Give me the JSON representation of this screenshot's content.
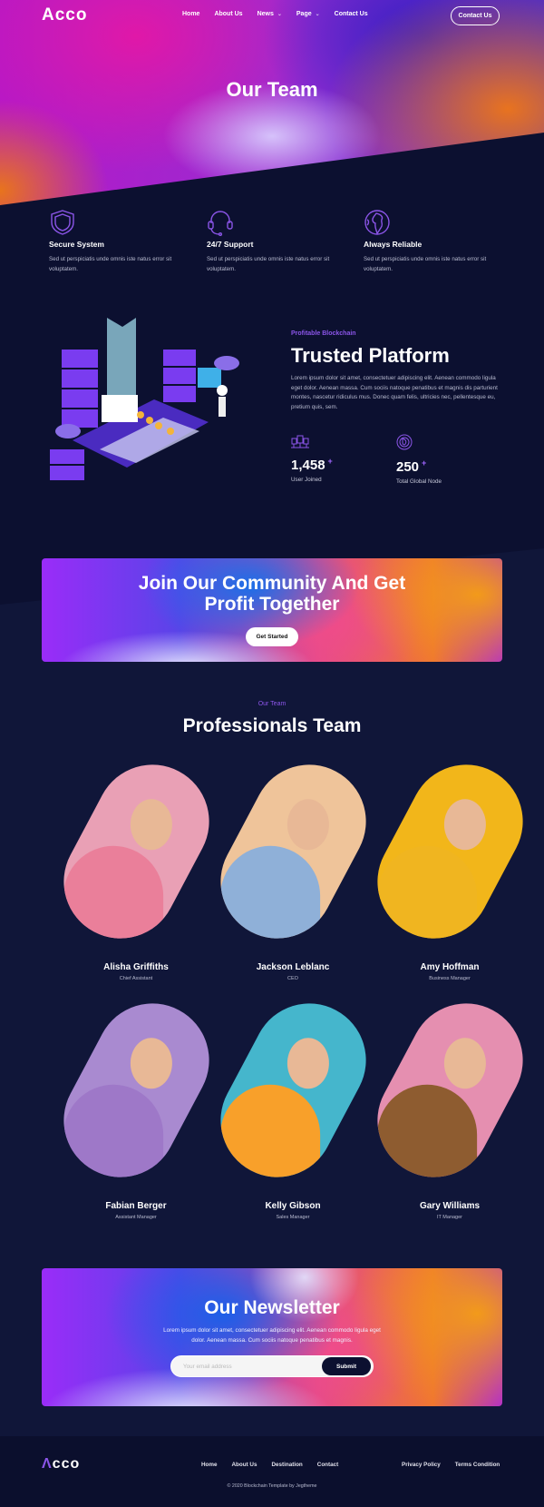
{
  "brand": {
    "logo": "Acco",
    "accent": "#8b55e8",
    "bg_dark": "#0c1030",
    "bg": "#101639"
  },
  "nav": {
    "items": [
      {
        "label": "Home"
      },
      {
        "label": "About Us"
      },
      {
        "label": "News",
        "dropdown": true
      },
      {
        "label": "Page",
        "dropdown": true
      },
      {
        "label": "Contact Us"
      }
    ],
    "cta": "Contact Us"
  },
  "hero": {
    "title": "Our Team"
  },
  "features": [
    {
      "icon": "shield-icon",
      "title": "Secure System",
      "text": "Sed ut perspiciatis unde omnis iste natus error sit voluptatem."
    },
    {
      "icon": "headset-icon",
      "title": "24/7 Support",
      "text": "Sed ut perspiciatis unde omnis iste natus error sit voluptatem."
    },
    {
      "icon": "globe-icon",
      "title": "Always Reliable",
      "text": "Sed ut perspiciatis unde omnis iste natus error sit voluptatem."
    }
  ],
  "platform": {
    "kicker": "Profitable Blockchain",
    "title": "Trusted Platform",
    "text": "Lorem ipsum dolor sit amet, consectetuer adipiscing elit. Aenean commodo ligula eget dolor. Aenean massa. Cum sociis natoque penatibus et magnis dis parturient montes, nascetur ridiculus mus. Donec quam felis, ultricies nec, pellentesque eu, pretium quis, sem.",
    "stats": [
      {
        "icon": "users-icon",
        "value": "1,458",
        "suffix": "+",
        "label": "User Joined"
      },
      {
        "icon": "global-node-icon",
        "value": "250",
        "suffix": "+",
        "label": "Total Global Node"
      }
    ]
  },
  "cta": {
    "title": "Join Our Community And Get Profit Together",
    "button": "Get Started"
  },
  "team": {
    "kicker": "Our Team",
    "title": "Professionals Team",
    "members": [
      {
        "name": "Alisha Griffiths",
        "role": "Chief Assistant",
        "bg": "#e9a0b5",
        "shirt": "#ea7f9a"
      },
      {
        "name": "Jackson Leblanc",
        "role": "CEO",
        "bg": "#efc49a",
        "shirt": "#8fb0d8"
      },
      {
        "name": "Amy Hoffman",
        "role": "Business Manager",
        "bg": "#f2b61a",
        "shirt": "#f0b520"
      },
      {
        "name": "Fabian Berger",
        "role": "Assistant Manager",
        "bg": "#a98ad0",
        "shirt": "#9e78c8"
      },
      {
        "name": "Kelly Gibson",
        "role": "Sales Manager",
        "bg": "#45b6cc",
        "shirt": "#f8a02a"
      },
      {
        "name": "Gary Williams",
        "role": "IT Manager",
        "bg": "#e58fb0",
        "shirt": "#8e5c30"
      }
    ]
  },
  "newsletter": {
    "title": "Our Newsletter",
    "text": "Lorem ipsum dolor sit amet, consectetuer adipiscing elit. Aenean commodo ligula eget dolor. Aenean massa. Cum sociis natoque penatibus et magnis.",
    "placeholder": "Your email address",
    "button": "Submit"
  },
  "footer": {
    "logo": "Acco",
    "links": [
      {
        "label": "Home"
      },
      {
        "label": "About Us"
      },
      {
        "label": "Destination"
      },
      {
        "label": "Contact"
      }
    ],
    "legal": [
      {
        "label": "Privacy Policy"
      },
      {
        "label": "Terms Condition"
      }
    ],
    "copyright": "© 2020 Blockchain Template by Jegtheme"
  }
}
